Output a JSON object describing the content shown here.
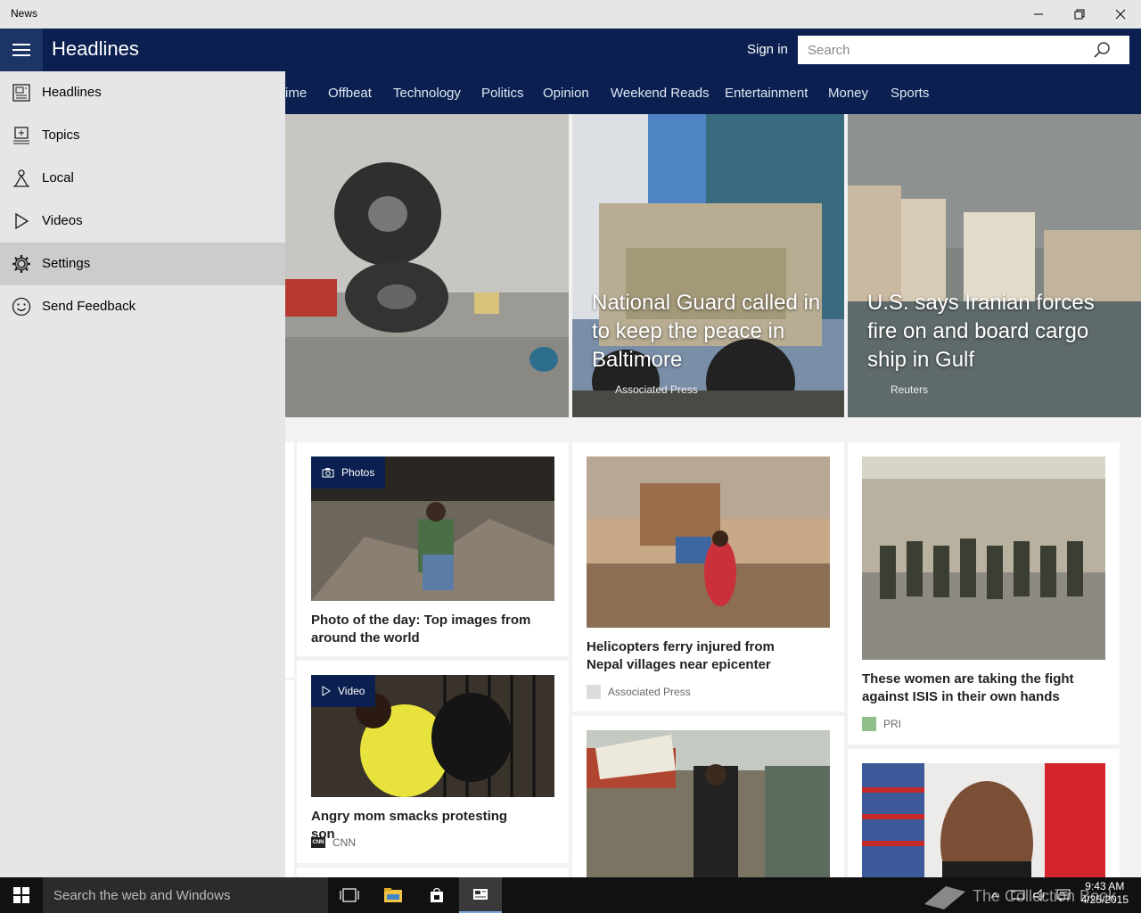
{
  "window": {
    "title": "News"
  },
  "header": {
    "page_title": "Headlines",
    "sign_in": "Sign in",
    "search_placeholder": "Search"
  },
  "categories": [
    "ime",
    "Offbeat",
    "Technology",
    "Politics",
    "Opinion",
    "Weekend Reads",
    "Entertainment",
    "Money",
    "Sports"
  ],
  "hero": [
    {
      "headline": "",
      "source": ""
    },
    {
      "headline": "National Guard called in to keep the peace in Baltimore",
      "source": "Associated Press"
    },
    {
      "headline": "U.S. says Iranian forces fire on and board cargo ship in Gulf",
      "source": "Reuters"
    }
  ],
  "cards": [
    {
      "title": "Photo of the day: Top images from around the world",
      "badge": "Photos",
      "source": ""
    },
    {
      "title": "Angry mom smacks protesting son",
      "badge": "Video",
      "source": "CNN",
      "source_logo": "CNN"
    },
    {
      "title": "Helicopters ferry injured from Nepal villages near epicenter",
      "source": "Associated Press"
    },
    {
      "title": "",
      "source": ""
    },
    {
      "title": "These women are taking the fight against ISIS in their own hands",
      "source": "PRI"
    },
    {
      "title": "",
      "source": ""
    }
  ],
  "nav_pane": {
    "items": [
      {
        "label": "Headlines",
        "icon": "newspaper-icon"
      },
      {
        "label": "Topics",
        "icon": "topics-icon"
      },
      {
        "label": "Local",
        "icon": "local-icon"
      },
      {
        "label": "Videos",
        "icon": "play-icon"
      },
      {
        "label": "Settings",
        "icon": "gear-icon",
        "active": true
      },
      {
        "label": "Send Feedback",
        "icon": "smiley-icon"
      }
    ]
  },
  "taskbar": {
    "search_placeholder": "Search the web and Windows",
    "time": "9:43 AM",
    "date": "4/25/2015",
    "watermark": "The Collection Book"
  },
  "colors": {
    "header": "#0b2050",
    "pane": "#e6e6e6",
    "active_item": "#cccccc",
    "taskbar": "#111111"
  }
}
